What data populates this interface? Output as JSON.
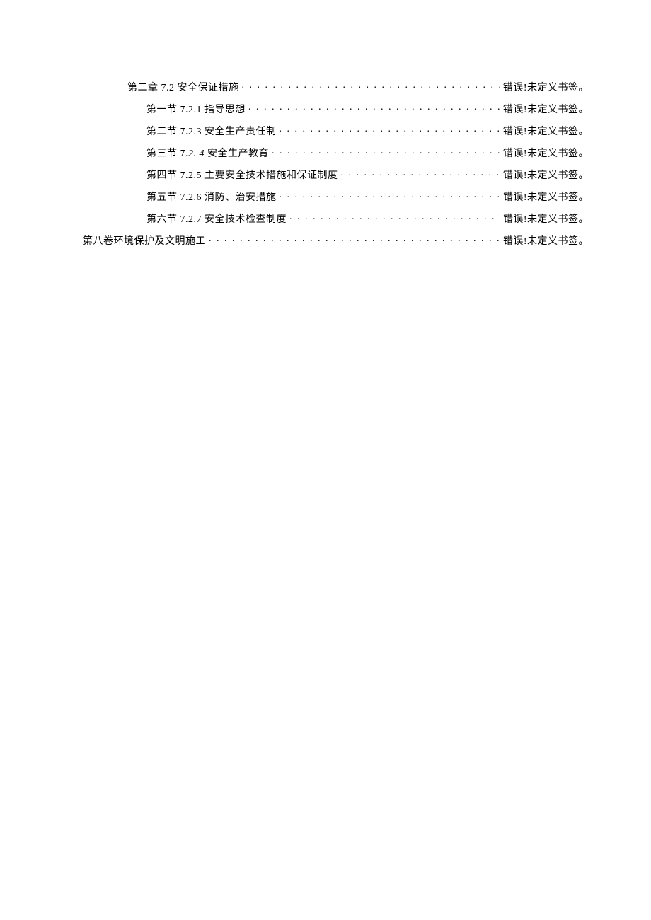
{
  "toc": {
    "prefix_chapter": "第二章",
    "prefix_section": {
      "s1": "第一节",
      "s2": "第二节",
      "s3": "第三节",
      "s4": "第四节",
      "s5": "第五节",
      "s6": "第六节"
    },
    "prefix_volume": "第八卷",
    "numbers": {
      "ch": "7.2",
      "s1": "7.2.1",
      "s2": "7.2.3",
      "s3a": "7.",
      "s3b": "2. 4",
      "s4": "7.2.5",
      "s5": "7.2.6",
      "s6": "7.2.7"
    },
    "titles": {
      "ch": "安全保证措施",
      "s1": "指导思想",
      "s2": "安全生产责任制",
      "s3": "安全生产教育",
      "s4": "主要安全技术措施和保证制度",
      "s5": "消防、治安措施",
      "s6": "安全技术检查制度",
      "vol": "环境保护及文明施工"
    },
    "page_ref": "错误!未定义书签。"
  }
}
